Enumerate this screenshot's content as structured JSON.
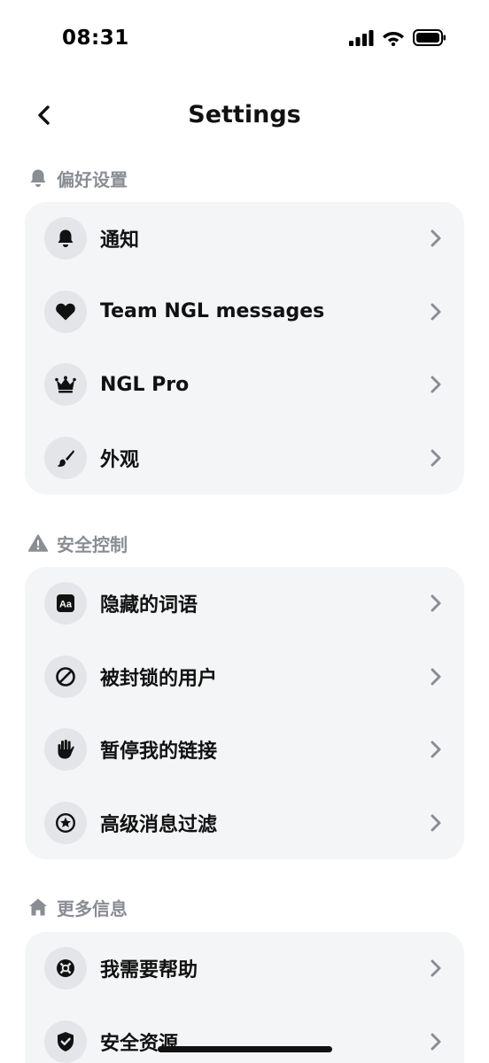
{
  "status_bar": {
    "time": "08:31"
  },
  "nav": {
    "title": "Settings"
  },
  "sections": [
    {
      "header": "偏好设置",
      "items": [
        {
          "label": "通知",
          "icon": "bell-icon"
        },
        {
          "label": "Team NGL messages",
          "icon": "heart-icon"
        },
        {
          "label": "NGL Pro",
          "icon": "crown-icon"
        },
        {
          "label": "外观",
          "icon": "paintbrush-icon"
        }
      ]
    },
    {
      "header": "安全控制",
      "items": [
        {
          "label": "隐藏的词语",
          "icon": "text-aa-icon"
        },
        {
          "label": "被封锁的用户",
          "icon": "blocked-icon"
        },
        {
          "label": "暂停我的链接",
          "icon": "hand-icon"
        },
        {
          "label": "高级消息过滤",
          "icon": "star-badge-icon"
        }
      ]
    },
    {
      "header": "更多信息",
      "items": [
        {
          "label": "我需要帮助",
          "icon": "lifebuoy-icon"
        },
        {
          "label": "安全资源",
          "icon": "shield-check-icon"
        }
      ]
    }
  ],
  "colors": {
    "card_bg": "#f4f5f7",
    "icon_bg": "#e4e5e9",
    "section_text": "#8a8d93",
    "chevron": "#8a8d93"
  }
}
